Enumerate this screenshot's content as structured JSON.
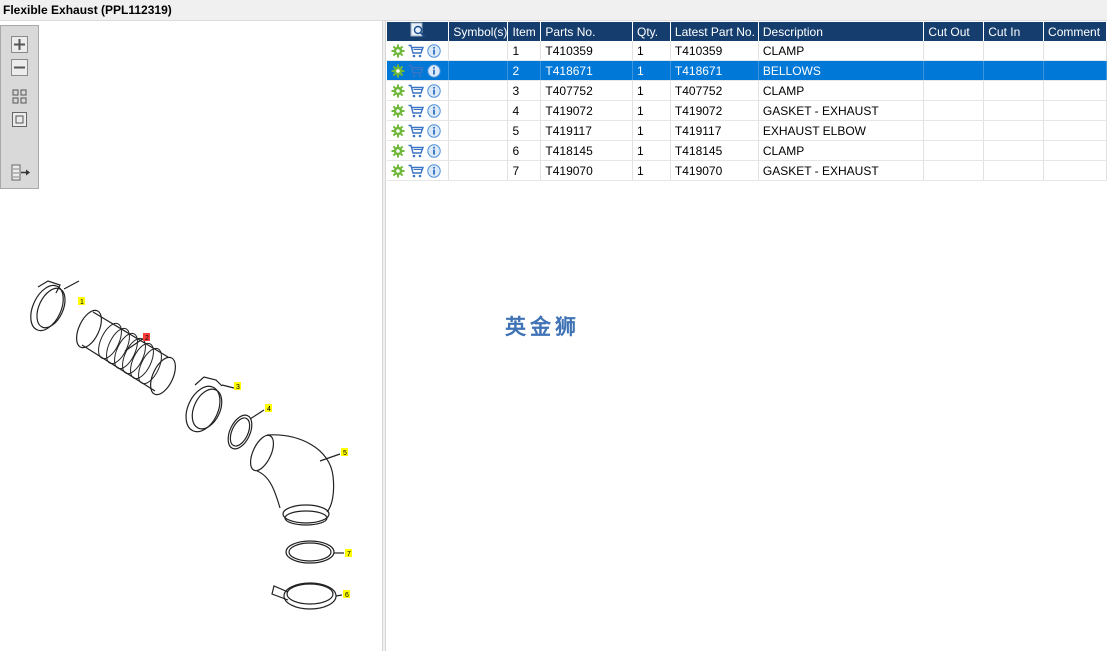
{
  "window": {
    "title": "Flexible Exhaust (PPL112319)"
  },
  "toolbar": {
    "zoom_in": "zoom-in",
    "zoom_out": "zoom-out",
    "fit_all": "fit-all",
    "fit_box": "fit-box",
    "export": "export"
  },
  "diagram": {
    "callouts": [
      "1",
      "2",
      "3",
      "4",
      "5",
      "6",
      "7"
    ],
    "highlighted_callout": "2",
    "colors": {
      "callout": "#ffff00",
      "callout_highlight": "#ff3b3b",
      "line": "#222222"
    }
  },
  "table": {
    "columns": [
      "",
      "Symbol(s)",
      "Item",
      "Parts No.",
      "Qty.",
      "Latest Part No.",
      "Description",
      "Cut Out",
      "Cut In",
      "Comment"
    ],
    "selected_row": 1,
    "rows": [
      {
        "symbols": "",
        "item": "1",
        "part_no": "T410359",
        "qty": "1",
        "latest": "T410359",
        "desc": "CLAMP",
        "cut_out": "",
        "cut_in": "",
        "comment": ""
      },
      {
        "symbols": "",
        "item": "2",
        "part_no": "T418671",
        "qty": "1",
        "latest": "T418671",
        "desc": "BELLOWS",
        "cut_out": "",
        "cut_in": "",
        "comment": ""
      },
      {
        "symbols": "",
        "item": "3",
        "part_no": "T407752",
        "qty": "1",
        "latest": "T407752",
        "desc": "CLAMP",
        "cut_out": "",
        "cut_in": "",
        "comment": ""
      },
      {
        "symbols": "",
        "item": "4",
        "part_no": "T419072",
        "qty": "1",
        "latest": "T419072",
        "desc": "GASKET - EXHAUST",
        "cut_out": "",
        "cut_in": "",
        "comment": ""
      },
      {
        "symbols": "",
        "item": "5",
        "part_no": "T419117",
        "qty": "1",
        "latest": "T419117",
        "desc": "EXHAUST ELBOW",
        "cut_out": "",
        "cut_in": "",
        "comment": ""
      },
      {
        "symbols": "",
        "item": "6",
        "part_no": "T418145",
        "qty": "1",
        "latest": "T418145",
        "desc": "CLAMP",
        "cut_out": "",
        "cut_in": "",
        "comment": ""
      },
      {
        "symbols": "",
        "item": "7",
        "part_no": "T419070",
        "qty": "1",
        "latest": "T419070",
        "desc": "GASKET - EXHAUST",
        "cut_out": "",
        "cut_in": "",
        "comment": ""
      }
    ],
    "row_icons": [
      "gear-icon",
      "cart-icon",
      "info-icon"
    ],
    "colors": {
      "header": "#153d6e",
      "selected": "#0078d7",
      "gear": "#6fb83a",
      "cart": "#3a74c4",
      "info": "#4a8fd9"
    }
  },
  "watermark": {
    "text": "英金狮",
    "color": "#3f73b5"
  }
}
